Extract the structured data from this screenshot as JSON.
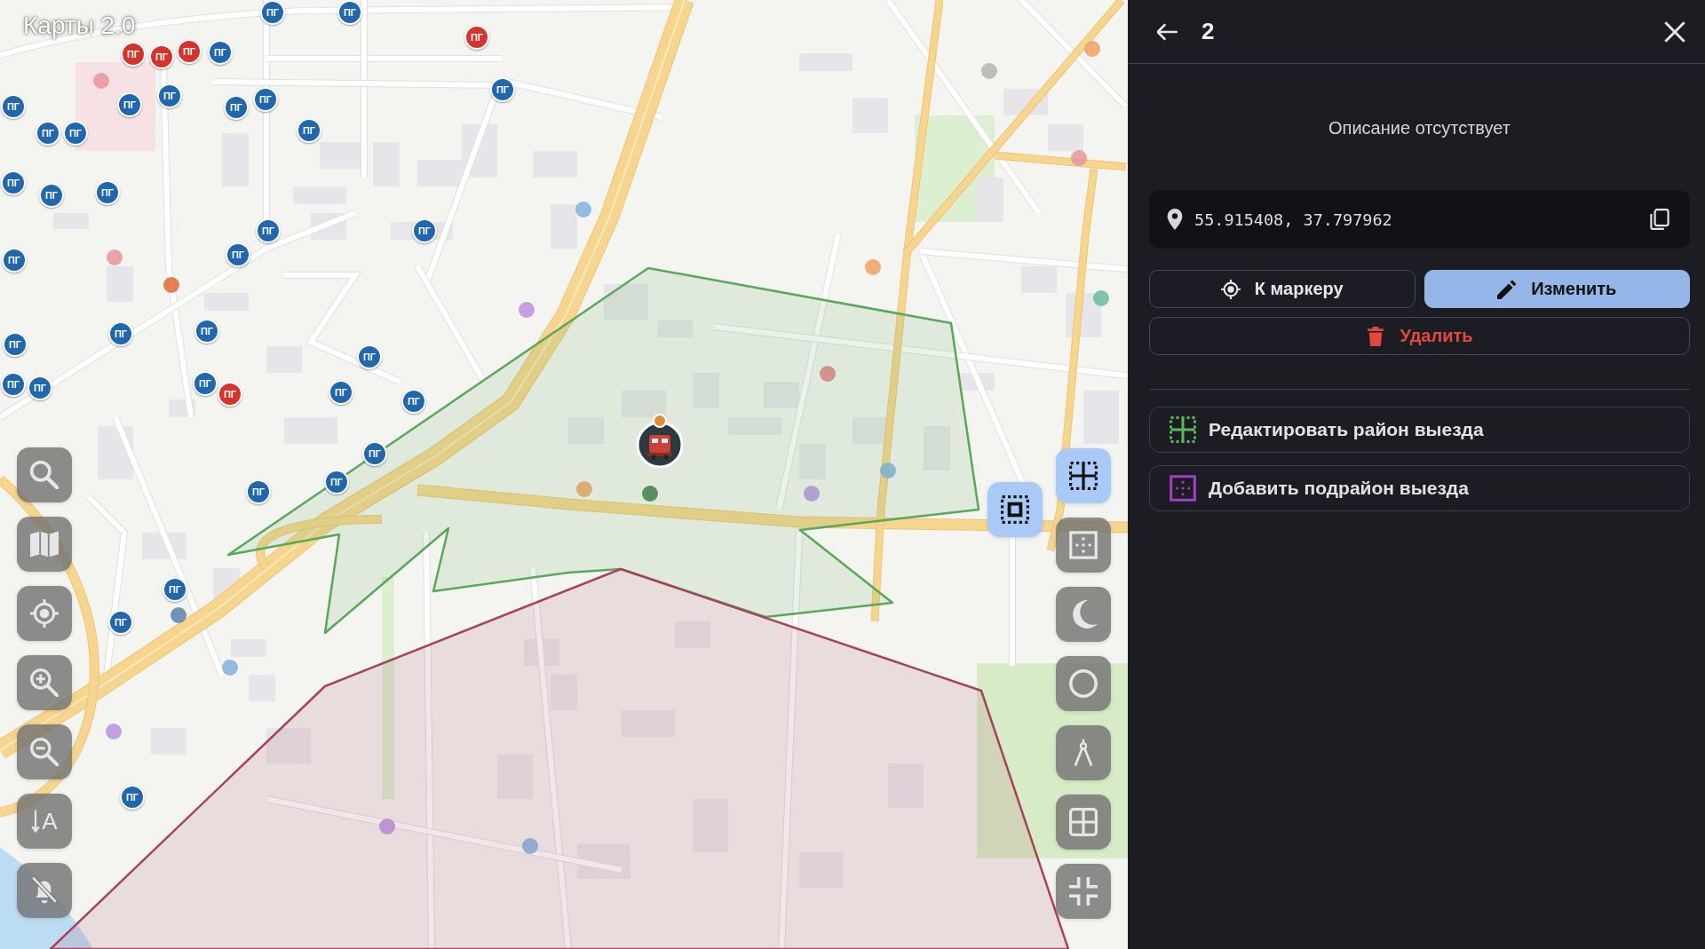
{
  "map": {
    "title": "Карты 2.0",
    "areas": [
      {
        "color": "#5aa85a"
      },
      {
        "color": "#a8435e"
      }
    ],
    "hydrants": [
      {
        "label": "ПГ",
        "color": "#2067ae"
      },
      {
        "label": "ПГ",
        "color": "#2067ae"
      },
      {
        "label": "ПГ",
        "color": "#d3342b"
      },
      {
        "label": "ПГ",
        "color": "#d3342b"
      },
      {
        "label": "ПГ",
        "color": "#d3342b"
      },
      {
        "label": "ПГ",
        "color": "#2067ae"
      },
      {
        "label": "ПГ",
        "color": "#d3342b"
      },
      {
        "label": "ПГ",
        "color": "#2067ae"
      },
      {
        "label": "ПГ",
        "color": "#2067ae"
      },
      {
        "label": "ПГ",
        "color": "#2067ae"
      },
      {
        "label": "ПГ",
        "color": "#2067ae"
      },
      {
        "label": "ПГ",
        "color": "#2067ae"
      },
      {
        "label": "ПГ",
        "color": "#2067ae"
      },
      {
        "label": "ПГ",
        "color": "#2067ae"
      },
      {
        "label": "ПГ",
        "color": "#2067ae"
      },
      {
        "label": "ПГ",
        "color": "#2067ae"
      },
      {
        "label": "ПГ",
        "color": "#2067ae"
      },
      {
        "label": "ПГ",
        "color": "#2067ae"
      },
      {
        "label": "ПГ",
        "color": "#2067ae"
      },
      {
        "label": "ПГ",
        "color": "#2067ae"
      },
      {
        "label": "ПГ",
        "color": "#2067ae"
      },
      {
        "label": "ПГ",
        "color": "#2067ae"
      },
      {
        "label": "ПГ",
        "color": "#2067ae"
      },
      {
        "label": "ПГ",
        "color": "#2067ae"
      },
      {
        "label": "ПГ",
        "color": "#2067ae"
      },
      {
        "label": "ПГ",
        "color": "#2067ae"
      },
      {
        "label": "ПГ",
        "color": "#2067ae"
      },
      {
        "label": "ПГ",
        "color": "#2067ae"
      },
      {
        "label": "ПГ",
        "color": "#2067ae"
      },
      {
        "label": "ПГ",
        "color": "#2067ae"
      },
      {
        "label": "ПГ",
        "color": "#d3342b"
      },
      {
        "label": "ПГ",
        "color": "#2067ae"
      },
      {
        "label": "ПГ",
        "color": "#2067ae"
      },
      {
        "label": "ПГ",
        "color": "#2067ae"
      },
      {
        "label": "ПГ",
        "color": "#2067ae"
      },
      {
        "label": "ПГ",
        "color": "#2067ae"
      },
      {
        "label": "ПГ",
        "color": "#2067ae"
      },
      {
        "label": "ПГ",
        "color": "#2067ae"
      },
      {
        "label": "ПГ",
        "color": "#2067ae"
      }
    ],
    "vehicle": {
      "kind": "fire_truck"
    },
    "left_tools": [
      {
        "kind": "search"
      },
      {
        "kind": "layers"
      },
      {
        "kind": "locate"
      },
      {
        "kind": "zoom_in"
      },
      {
        "kind": "zoom_out"
      },
      {
        "kind": "labels",
        "glyph": "A"
      },
      {
        "kind": "mute"
      }
    ],
    "right_tools": [
      {
        "kind": "edit_area",
        "active": true
      },
      {
        "kind": "subarea",
        "active": false
      },
      {
        "kind": "theme",
        "active": false
      },
      {
        "kind": "circle",
        "active": false
      },
      {
        "kind": "measure",
        "active": false
      },
      {
        "kind": "grid",
        "active": false
      },
      {
        "kind": "collapse",
        "active": false
      }
    ],
    "floating_tool": {
      "kind": "select_area",
      "active": true
    }
  },
  "panel": {
    "title": "2",
    "description": "Описание отсутствует",
    "coordinates": "55.915408, 37.797962",
    "actions": [
      {
        "kind": "locate",
        "label": "К маркеру"
      },
      {
        "kind": "edit",
        "label": "Изменить"
      },
      {
        "kind": "delete",
        "label": "Удалить"
      }
    ],
    "area_actions": [
      {
        "kind": "edit_area",
        "label": "Редактировать район выезда"
      },
      {
        "kind": "add_subarea",
        "label": "Добавить подрайон выезда"
      }
    ]
  }
}
